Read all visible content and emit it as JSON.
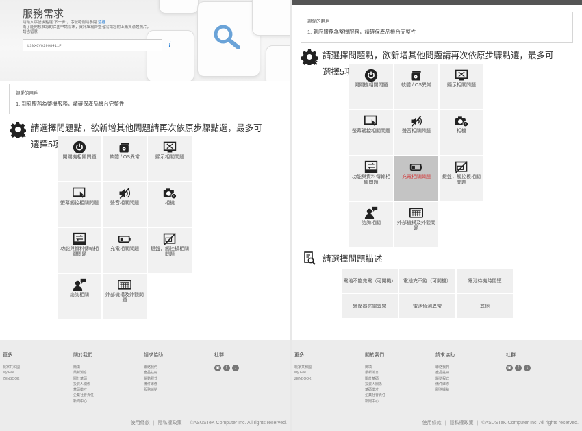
{
  "hero": {
    "title": "服務需求",
    "desc_line1": "請輸入序號後點選\"下一步\"，序號範例請參閱",
    "desc_link": "這裡",
    "desc_line2": "為了能夠核准您的保固申請需求，資訊填寫齊整者需請您附上購買憑證照片，",
    "desc_line3": "請也留意",
    "serial_value": "L3NXCV02998411F",
    "info_glyph": "i"
  },
  "notice": {
    "title": "親愛的用戶",
    "item": "1.  到府服務為整機服務，請確保產品機台完整性"
  },
  "problem_section": {
    "heading_line1": "請選擇問題點，欲新增其他問題請再次依原步驟點選，最多可",
    "heading_line2": "選擇5項",
    "tiles": [
      {
        "label": "開關機相關問題",
        "icon": "power-icon"
      },
      {
        "label": "軟體 / OS異常",
        "icon": "software-icon"
      },
      {
        "label": "顯示相關問題",
        "icon": "display-icon"
      },
      {
        "label": "螢幕觸控相關問題",
        "icon": "touchscreen-icon"
      },
      {
        "label": "聲音相關問題",
        "icon": "mute-speaker-icon"
      },
      {
        "label": "相機",
        "icon": "camera-icon"
      },
      {
        "label": "功能與資料傳輸相關問題",
        "icon": "data-transfer-icon"
      },
      {
        "label": "充電相關問題",
        "icon": "battery-icon"
      },
      {
        "label": "鍵盤，觸控板相關問題",
        "icon": "keyboard-touchpad-icon"
      },
      {
        "label": "諮詢相關",
        "icon": "consult-icon"
      },
      {
        "label": "外部機構及外觀問題",
        "icon": "chassis-icon"
      }
    ],
    "active_index_right": 7
  },
  "describe_section": {
    "heading": "請選擇問題描述",
    "options": [
      "電池不能充電（可開機）",
      "電池充不飽（可開機）",
      "電池待機時間短",
      "變壓器充電異常",
      "電池偵測異常",
      "其他"
    ]
  },
  "footer": {
    "col1": {
      "title": "更多",
      "links": [
        "玩家共和國",
        "My Eee",
        "ZENBOOK"
      ]
    },
    "col2": {
      "title": "關於我們",
      "links": [
        "簡填",
        "最新消息",
        "關於華碩",
        "投資人關係",
        "華碩徵才",
        "企業社會責任",
        "新聞中心"
      ]
    },
    "col3": {
      "title": "請求協助",
      "links": [
        "聯絡我們",
        "產品註冊",
        "驅動程式",
        "備件維修",
        "服務據點"
      ]
    },
    "col4": {
      "title": "社群"
    },
    "terms": "使用條款",
    "privacy": "隱私權政策",
    "copyright": "©ASUSTeK Computer Inc. All rights reserved."
  },
  "colors": {
    "active_tile": "#c4c4c4",
    "active_label": "#d23b3b",
    "link": "#2a7fd4"
  }
}
